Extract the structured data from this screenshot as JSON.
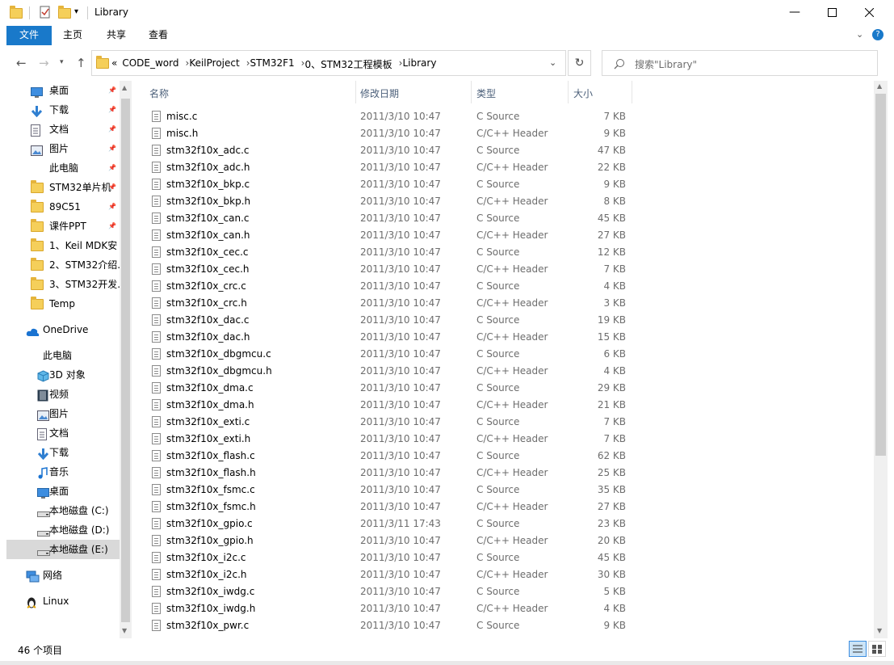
{
  "window": {
    "title": "Library"
  },
  "ribbon": {
    "tabs": [
      "文件",
      "主页",
      "共享",
      "查看"
    ]
  },
  "address": {
    "crumbs": [
      "«",
      "CODE_word",
      "KeilProject",
      "STM32F1",
      "0、STM32工程模板",
      "Library"
    ]
  },
  "search": {
    "placeholder": "搜索\"Library\""
  },
  "nav": {
    "items": [
      {
        "label": "桌面",
        "icon": "desktop-icon",
        "pinned": true
      },
      {
        "label": "下载",
        "icon": "download-icon",
        "pinned": true
      },
      {
        "label": "文档",
        "icon": "document-icon",
        "pinned": true
      },
      {
        "label": "图片",
        "icon": "picture-icon",
        "pinned": true
      },
      {
        "label": "此电脑",
        "icon": "",
        "pinned": true
      },
      {
        "label": "STM32单片机",
        "icon": "folder-icon",
        "pinned": true
      },
      {
        "label": "89C51",
        "icon": "folder-icon",
        "pinned": true
      },
      {
        "label": "课件PPT",
        "icon": "folder-icon",
        "pinned": true
      },
      {
        "label": "1、Keil MDK安",
        "icon": "folder-icon",
        "pinned": false
      },
      {
        "label": "2、STM32介绍.",
        "icon": "folder-icon",
        "pinned": false
      },
      {
        "label": "3、STM32开发.",
        "icon": "folder-icon",
        "pinned": false
      },
      {
        "label": "Temp",
        "icon": "folder-icon",
        "pinned": false
      },
      {
        "label": "OneDrive",
        "icon": "cloud-icon",
        "pinned": false
      },
      {
        "label": "此电脑",
        "icon": "",
        "pinned": false
      },
      {
        "label": "3D 对象",
        "icon": "cube-icon",
        "pinned": false
      },
      {
        "label": "视频",
        "icon": "video-icon",
        "pinned": false
      },
      {
        "label": "图片",
        "icon": "picture-icon",
        "pinned": false
      },
      {
        "label": "文档",
        "icon": "document-icon",
        "pinned": false
      },
      {
        "label": "下载",
        "icon": "download-icon",
        "pinned": false
      },
      {
        "label": "音乐",
        "icon": "music-icon",
        "pinned": false
      },
      {
        "label": "桌面",
        "icon": "desktop-icon",
        "pinned": false
      },
      {
        "label": "本地磁盘 (C:)",
        "icon": "drive-icon",
        "pinned": false
      },
      {
        "label": "本地磁盘 (D:)",
        "icon": "drive-icon",
        "pinned": false
      },
      {
        "label": "本地磁盘 (E:)",
        "icon": "drive-icon",
        "pinned": false,
        "selected": true
      },
      {
        "label": "网络",
        "icon": "network-icon",
        "pinned": false
      },
      {
        "label": "Linux",
        "icon": "linux-icon",
        "pinned": false
      }
    ]
  },
  "columns": {
    "name": "名称",
    "date": "修改日期",
    "type": "类型",
    "size": "大小"
  },
  "files": [
    {
      "name": "misc.c",
      "date": "2011/3/10 10:47",
      "type": "C Source",
      "size": "7 KB"
    },
    {
      "name": "misc.h",
      "date": "2011/3/10 10:47",
      "type": "C/C++ Header",
      "size": "9 KB"
    },
    {
      "name": "stm32f10x_adc.c",
      "date": "2011/3/10 10:47",
      "type": "C Source",
      "size": "47 KB"
    },
    {
      "name": "stm32f10x_adc.h",
      "date": "2011/3/10 10:47",
      "type": "C/C++ Header",
      "size": "22 KB"
    },
    {
      "name": "stm32f10x_bkp.c",
      "date": "2011/3/10 10:47",
      "type": "C Source",
      "size": "9 KB"
    },
    {
      "name": "stm32f10x_bkp.h",
      "date": "2011/3/10 10:47",
      "type": "C/C++ Header",
      "size": "8 KB"
    },
    {
      "name": "stm32f10x_can.c",
      "date": "2011/3/10 10:47",
      "type": "C Source",
      "size": "45 KB"
    },
    {
      "name": "stm32f10x_can.h",
      "date": "2011/3/10 10:47",
      "type": "C/C++ Header",
      "size": "27 KB"
    },
    {
      "name": "stm32f10x_cec.c",
      "date": "2011/3/10 10:47",
      "type": "C Source",
      "size": "12 KB"
    },
    {
      "name": "stm32f10x_cec.h",
      "date": "2011/3/10 10:47",
      "type": "C/C++ Header",
      "size": "7 KB"
    },
    {
      "name": "stm32f10x_crc.c",
      "date": "2011/3/10 10:47",
      "type": "C Source",
      "size": "4 KB"
    },
    {
      "name": "stm32f10x_crc.h",
      "date": "2011/3/10 10:47",
      "type": "C/C++ Header",
      "size": "3 KB"
    },
    {
      "name": "stm32f10x_dac.c",
      "date": "2011/3/10 10:47",
      "type": "C Source",
      "size": "19 KB"
    },
    {
      "name": "stm32f10x_dac.h",
      "date": "2011/3/10 10:47",
      "type": "C/C++ Header",
      "size": "15 KB"
    },
    {
      "name": "stm32f10x_dbgmcu.c",
      "date": "2011/3/10 10:47",
      "type": "C Source",
      "size": "6 KB"
    },
    {
      "name": "stm32f10x_dbgmcu.h",
      "date": "2011/3/10 10:47",
      "type": "C/C++ Header",
      "size": "4 KB"
    },
    {
      "name": "stm32f10x_dma.c",
      "date": "2011/3/10 10:47",
      "type": "C Source",
      "size": "29 KB"
    },
    {
      "name": "stm32f10x_dma.h",
      "date": "2011/3/10 10:47",
      "type": "C/C++ Header",
      "size": "21 KB"
    },
    {
      "name": "stm32f10x_exti.c",
      "date": "2011/3/10 10:47",
      "type": "C Source",
      "size": "7 KB"
    },
    {
      "name": "stm32f10x_exti.h",
      "date": "2011/3/10 10:47",
      "type": "C/C++ Header",
      "size": "7 KB"
    },
    {
      "name": "stm32f10x_flash.c",
      "date": "2011/3/10 10:47",
      "type": "C Source",
      "size": "62 KB"
    },
    {
      "name": "stm32f10x_flash.h",
      "date": "2011/3/10 10:47",
      "type": "C/C++ Header",
      "size": "25 KB"
    },
    {
      "name": "stm32f10x_fsmc.c",
      "date": "2011/3/10 10:47",
      "type": "C Source",
      "size": "35 KB"
    },
    {
      "name": "stm32f10x_fsmc.h",
      "date": "2011/3/10 10:47",
      "type": "C/C++ Header",
      "size": "27 KB"
    },
    {
      "name": "stm32f10x_gpio.c",
      "date": "2011/3/11 17:43",
      "type": "C Source",
      "size": "23 KB"
    },
    {
      "name": "stm32f10x_gpio.h",
      "date": "2011/3/10 10:47",
      "type": "C/C++ Header",
      "size": "20 KB"
    },
    {
      "name": "stm32f10x_i2c.c",
      "date": "2011/3/10 10:47",
      "type": "C Source",
      "size": "45 KB"
    },
    {
      "name": "stm32f10x_i2c.h",
      "date": "2011/3/10 10:47",
      "type": "C/C++ Header",
      "size": "30 KB"
    },
    {
      "name": "stm32f10x_iwdg.c",
      "date": "2011/3/10 10:47",
      "type": "C Source",
      "size": "5 KB"
    },
    {
      "name": "stm32f10x_iwdg.h",
      "date": "2011/3/10 10:47",
      "type": "C/C++ Header",
      "size": "4 KB"
    },
    {
      "name": "stm32f10x_pwr.c",
      "date": "2011/3/10 10:47",
      "type": "C Source",
      "size": "9 KB"
    }
  ],
  "status": {
    "item_count": "46 个项目"
  },
  "colors": {
    "accent": "#1979ca",
    "folder": "#f5cf5a",
    "selected_bg": "#d9d9d9"
  }
}
